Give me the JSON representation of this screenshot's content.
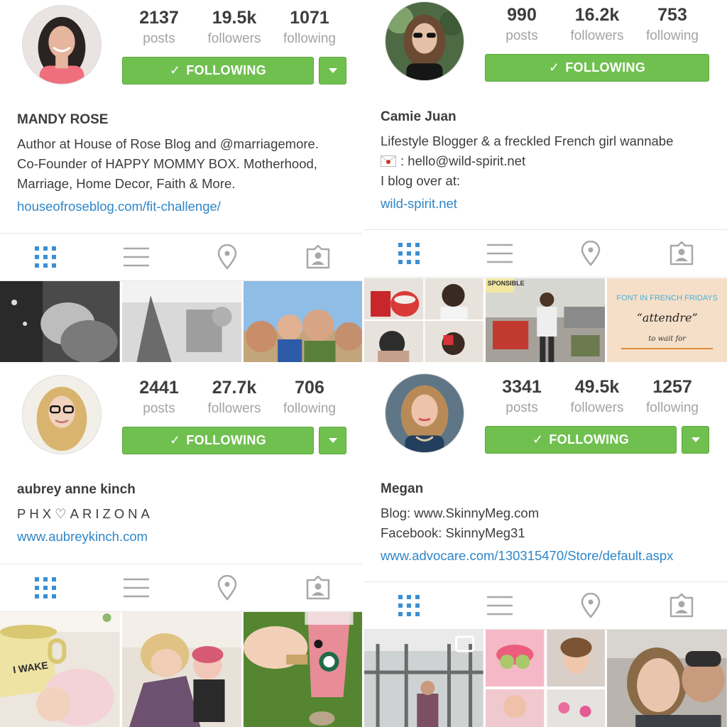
{
  "colors": {
    "follow_green": "#70c050",
    "link_blue": "#2f86c8",
    "active_tab_blue": "#3a8fd6",
    "inactive_icon_gray": "#a8a8a8"
  },
  "tabs": {
    "grid": "grid-icon",
    "list": "list-icon",
    "location": "location-pin-icon",
    "tagged": "tagged-photos-icon"
  },
  "profiles": [
    {
      "stats": [
        {
          "value": "2137",
          "label": "posts"
        },
        {
          "value": "19.5k",
          "label": "followers"
        },
        {
          "value": "1071",
          "label": "following"
        }
      ],
      "follow_label": "FOLLOWING",
      "name": "MANDY ROSE",
      "bio": [
        "Author at House of Rose Blog and @marriagemore.",
        "Co-Founder of HAPPY MOMMY BOX. Motherhood,",
        "Marriage, Home Decor, Faith & More."
      ],
      "link": "houseofroseblog.com/fit-challenge/"
    },
    {
      "stats": [
        {
          "value": "990",
          "label": "posts"
        },
        {
          "value": "16.2k",
          "label": "followers"
        },
        {
          "value": "753",
          "label": "following"
        }
      ],
      "follow_label": "FOLLOWING",
      "name": "Camie Juan",
      "bio": [
        "Lifestyle Blogger & a freckled French girl wannabe",
        ": hello@wild-spirit.net",
        "I blog over at:"
      ],
      "link": "wild-spirit.net",
      "thumb_text": {
        "sign": "SPONSIBLE",
        "header": "FONT IN FRENCH FRIDAYS",
        "word": "“attendre”",
        "sub": "to wait for"
      }
    },
    {
      "stats": [
        {
          "value": "2441",
          "label": "posts"
        },
        {
          "value": "27.7k",
          "label": "followers"
        },
        {
          "value": "706",
          "label": "following"
        }
      ],
      "follow_label": "FOLLOWING",
      "name": "aubrey anne kinch",
      "bio": [
        "PHX♡ARIZONA"
      ],
      "link": "www.aubreykinch.com",
      "thumb_text": {
        "mug": "I WAKE"
      }
    },
    {
      "stats": [
        {
          "value": "3341",
          "label": "posts"
        },
        {
          "value": "49.5k",
          "label": "followers"
        },
        {
          "value": "1257",
          "label": "following"
        }
      ],
      "follow_label": "FOLLOWING",
      "name": "Megan",
      "bio": [
        "Blog: www.SkinnyMeg.com",
        "Facebook: SkinnyMeg31"
      ],
      "link": "www.advocare.com/130315470/Store/default.aspx"
    }
  ]
}
